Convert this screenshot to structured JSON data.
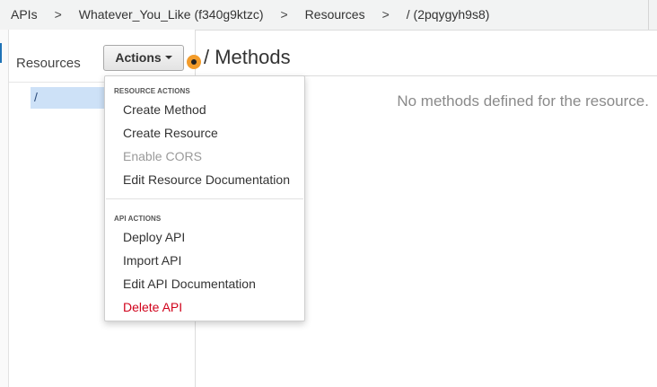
{
  "breadcrumb": {
    "items": [
      "APIs",
      "Whatever_You_Like (f340g9ktzc)",
      "Resources",
      "/ (2pqygyh9s8)"
    ],
    "separator": ">"
  },
  "resources": {
    "title": "Resources",
    "items": [
      {
        "label": "/"
      }
    ]
  },
  "actions": {
    "label": "Actions"
  },
  "methods": {
    "title": "/ Methods",
    "empty_message": "No methods defined for the resource."
  },
  "dropdown": {
    "resource_actions": {
      "header": "RESOURCE ACTIONS",
      "items": [
        "Create Method",
        "Create Resource",
        "Enable CORS",
        "Edit Resource Documentation"
      ]
    },
    "api_actions": {
      "header": "API ACTIONS",
      "items": [
        "Deploy API",
        "Import API",
        "Edit API Documentation",
        "Delete API"
      ]
    }
  },
  "colors": {
    "selected_bg": "#cde1f7",
    "danger": "#d0021b",
    "indicator": "#f39c2b",
    "disabled": "#9a9a9a"
  }
}
